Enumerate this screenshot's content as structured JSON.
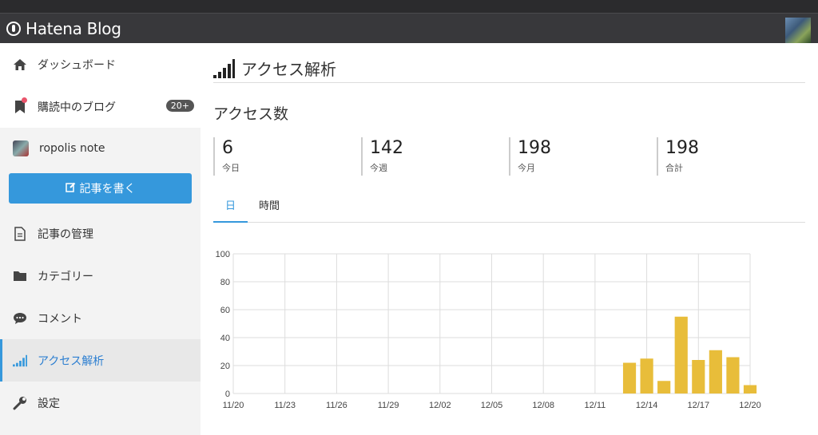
{
  "app": {
    "logo_text": "Hatena Blog"
  },
  "sidebar": {
    "items_top": [
      {
        "label": "ダッシュボード",
        "icon": "home-icon"
      },
      {
        "label": "購読中のブログ",
        "icon": "bookmark-icon",
        "badge": "20+"
      }
    ],
    "blog_name": "ropolis note",
    "write_button": "記事を書く",
    "items": [
      {
        "label": "記事の管理",
        "icon": "document-icon"
      },
      {
        "label": "カテゴリー",
        "icon": "folder-icon"
      },
      {
        "label": "コメント",
        "icon": "comment-icon"
      },
      {
        "label": "アクセス解析",
        "icon": "signal-bars-icon",
        "active": true
      },
      {
        "label": "設定",
        "icon": "wrench-icon"
      }
    ]
  },
  "main": {
    "title": "アクセス解析",
    "section_title": "アクセス数",
    "stats": [
      {
        "value": "6",
        "label": "今日"
      },
      {
        "value": "142",
        "label": "今週"
      },
      {
        "value": "198",
        "label": "今月"
      },
      {
        "value": "198",
        "label": "合計"
      }
    ],
    "tabs": [
      {
        "label": "日",
        "active": true
      },
      {
        "label": "時間",
        "active": false
      }
    ]
  },
  "chart_data": {
    "type": "bar",
    "x_ticks": [
      "11/20",
      "11/23",
      "11/26",
      "11/29",
      "12/02",
      "12/05",
      "12/08",
      "12/11",
      "12/14",
      "12/17",
      "12/20"
    ],
    "y_ticks": [
      "0",
      "20",
      "40",
      "60",
      "80",
      "100"
    ],
    "ylim": [
      0,
      100
    ],
    "bar_color": "#e8bd3a",
    "categories": [
      "12/13",
      "12/14",
      "12/15",
      "12/16",
      "12/17",
      "12/18",
      "12/19",
      "12/20"
    ],
    "values": [
      22,
      25,
      9,
      55,
      24,
      31,
      26,
      6
    ]
  }
}
